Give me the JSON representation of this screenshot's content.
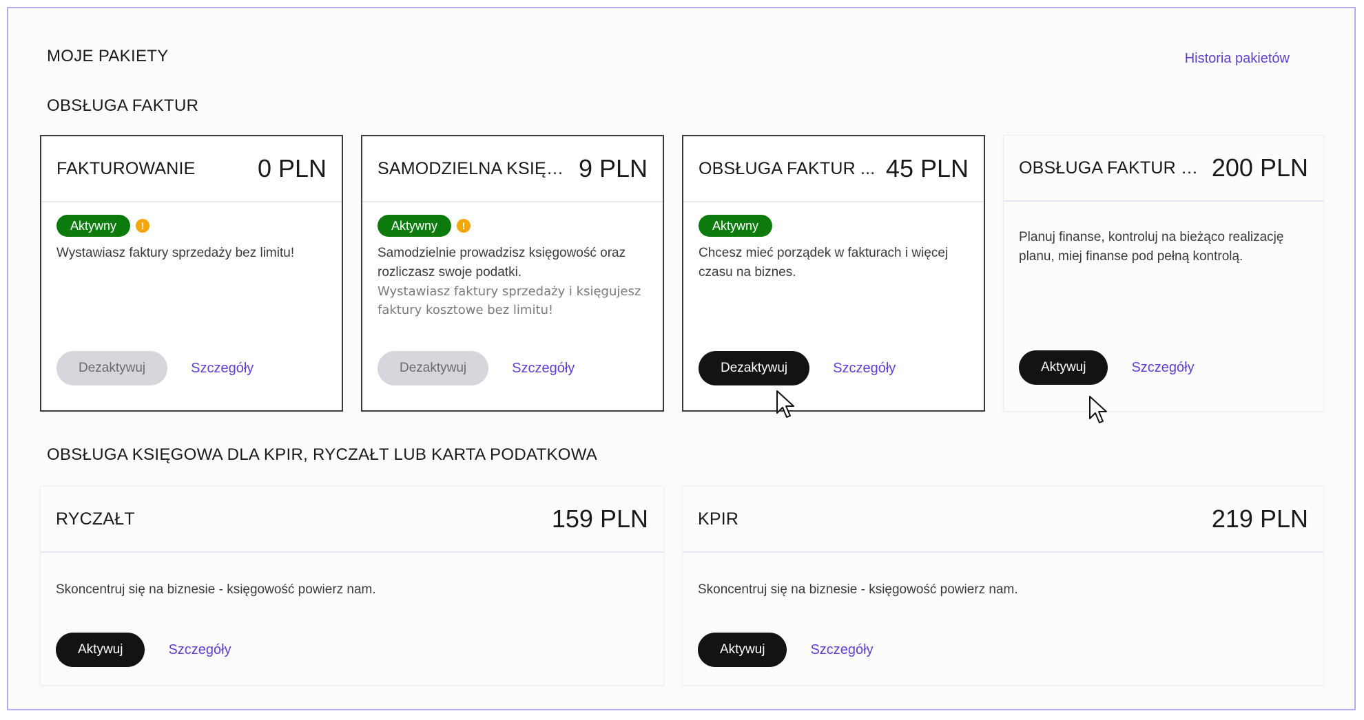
{
  "header": {
    "title": "MOJE PAKIETY",
    "history_link": "Historia pakietów"
  },
  "sections": [
    {
      "title": "OBSŁUGA FAKTUR",
      "cards": [
        {
          "name": "FAKTUROWANIE",
          "price": "0 PLN",
          "status": "Aktywny",
          "warning": "!",
          "description": "Wystawiasz faktury sprzedaży bez limitu!",
          "sub_description": "",
          "action": "Dezaktywuj",
          "details": "Szczegóły"
        },
        {
          "name": "SAMODZIELNA KSIĘG...",
          "price": "9 PLN",
          "status": "Aktywny",
          "warning": "!",
          "description": "Samodzielnie prowadzisz księgowość oraz rozliczasz swoje podatki.",
          "sub_description": "Wystawiasz faktury sprzedaży i księgujesz faktury kosztowe bez limitu!",
          "action": "Dezaktywuj",
          "details": "Szczegóły"
        },
        {
          "name": "OBSŁUGA FAKTUR ...",
          "price": "45 PLN",
          "status": "Aktywny",
          "description": "Chcesz mieć porządek w fakturach i więcej czasu na biznes.",
          "sub_description": "",
          "action": "Dezaktywuj",
          "details": "Szczegóły"
        },
        {
          "name": "OBSŁUGA FAKTUR D...",
          "price": "200 PLN",
          "description": "Planuj finanse, kontroluj na bieżąco realizację planu, miej finanse pod pełną kontrolą.",
          "sub_description": "",
          "action": "Aktywuj",
          "details": "Szczegóły"
        }
      ]
    },
    {
      "title": "OBSŁUGA KSIĘGOWA DLA KPIR, RYCZAŁT LUB KARTA PODATKOWA",
      "cards": [
        {
          "name": "RYCZAŁT",
          "price": "159 PLN",
          "description": "Skoncentruj się na biznesie - księgowość powierz nam.",
          "action": "Aktywuj",
          "details": "Szczegóły"
        },
        {
          "name": "KPIR",
          "price": "219 PLN",
          "description": "Skoncentruj się na biznesie - księgowość powierz nam.",
          "action": "Aktywuj",
          "details": "Szczegóły"
        }
      ]
    }
  ],
  "colors": {
    "accent_link": "#5b3fd3",
    "active_badge": "#0d7a0d",
    "warning": "#f5a60b",
    "primary_button": "#131313",
    "disabled_button": "#d6d6dc",
    "frame_border": "#b3abee"
  },
  "icons": [
    "warning-icon",
    "mouse-pointer-icon"
  ]
}
